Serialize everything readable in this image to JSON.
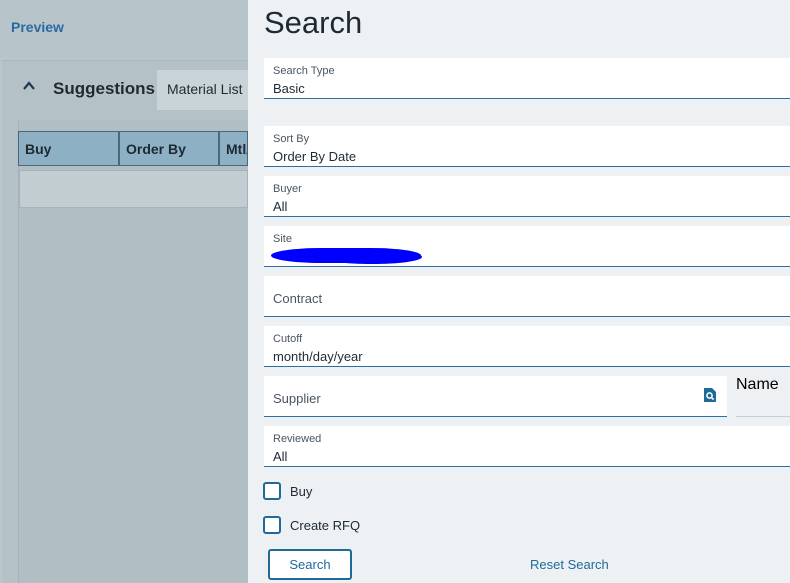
{
  "background": {
    "preview_link": "Preview",
    "suggestions_title": "Suggestions",
    "material_list_tab": "Material List",
    "grid_columns": [
      "Buy",
      "Order By",
      "Mtl/"
    ]
  },
  "search": {
    "title": "Search",
    "fields": {
      "search_type": {
        "label": "Search Type",
        "value": "Basic"
      },
      "sort_by": {
        "label": "Sort By",
        "value": "Order By Date"
      },
      "buyer": {
        "label": "Buyer",
        "value": "All"
      },
      "site": {
        "label": "Site",
        "value": ""
      },
      "contract": {
        "placeholder": "Contract"
      },
      "cutoff": {
        "label": "Cutoff",
        "value": "month/day/year"
      },
      "supplier": {
        "placeholder": "Supplier"
      },
      "name": {
        "placeholder": "Name"
      },
      "reviewed": {
        "label": "Reviewed",
        "value": "All"
      }
    },
    "checkboxes": {
      "buy": {
        "label": "Buy",
        "checked": false
      },
      "create_rfq": {
        "label": "Create RFQ",
        "checked": false
      }
    },
    "search_button": "Search",
    "reset_link": "Reset Search"
  },
  "colors": {
    "accent": "#1f6a99",
    "redaction": "#0000ff"
  }
}
